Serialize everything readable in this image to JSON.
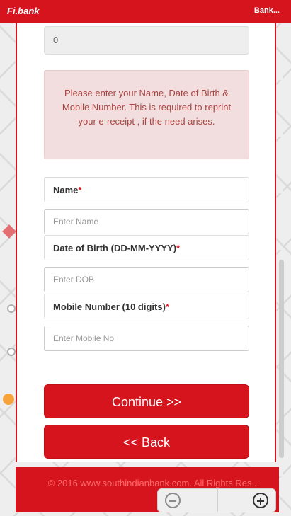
{
  "header": {
    "brand_left": "Fi.bank",
    "brand_right": "Bank..."
  },
  "top_field": {
    "value": "0"
  },
  "notice": {
    "text": "Please enter your Name, Date of Birth & Mobile Number. This is required to reprint your e-receipt , if the need arises."
  },
  "form": {
    "name": {
      "label": "Name",
      "required": "*",
      "placeholder": "Enter Name"
    },
    "dob": {
      "label": "Date of Birth (DD-MM-YYYY)",
      "required": "*",
      "placeholder": "Enter DOB"
    },
    "mobile": {
      "label": "Mobile Number (10 digits)",
      "required": "*",
      "placeholder": "Enter Mobile No"
    }
  },
  "buttons": {
    "continue": "Continue >>",
    "back": "<< Back"
  },
  "footer": {
    "text": "© 2016 www.southindianbank.com. All Rights Res..."
  },
  "colors": {
    "brand_red": "#d6141e",
    "notice_bg": "#f2dede",
    "notice_text": "#a94442"
  },
  "icons": {
    "zoom_out": "zoom-out-icon",
    "zoom_in": "zoom-in-icon"
  }
}
